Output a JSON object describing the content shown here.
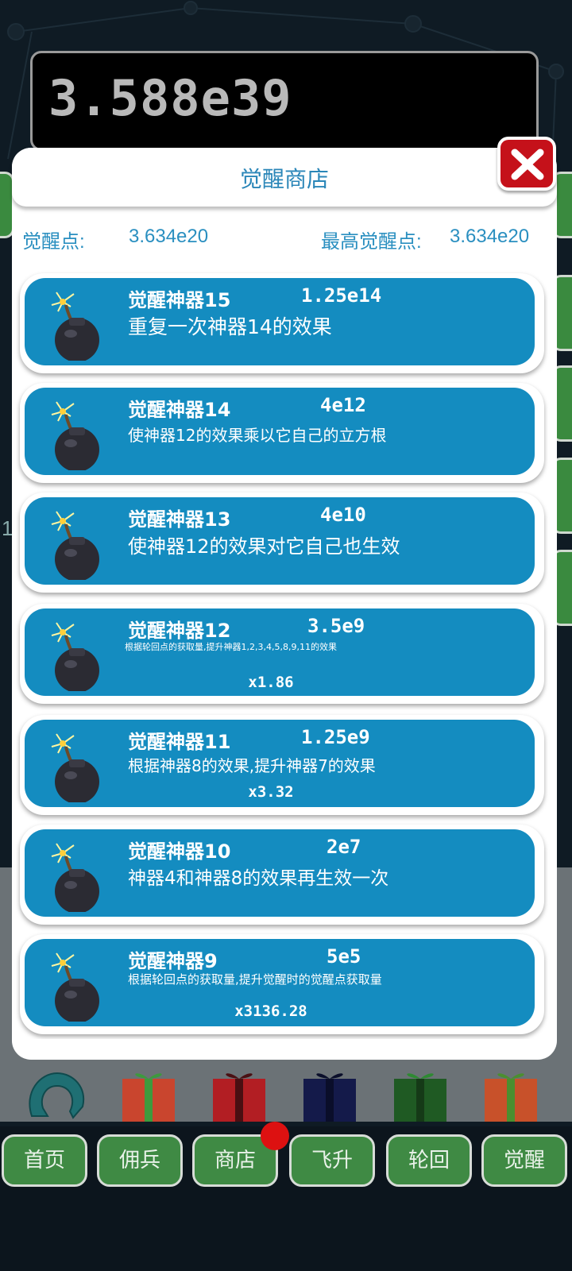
{
  "score": "3.588e39",
  "side_left_number": "1",
  "modal": {
    "title": "觉醒商店",
    "awaken_points_label": "觉醒点:",
    "awaken_points_value": "3.634e20",
    "max_awaken_points_label": "最高觉醒点:",
    "max_awaken_points_value": "3.634e20"
  },
  "items": [
    {
      "name": "觉醒神器15",
      "cost": "1.25e14",
      "desc": "重复一次神器14的效果",
      "mult": ""
    },
    {
      "name": "觉醒神器14",
      "cost": "4e12",
      "desc": "使神器12的效果乘以它自己的立方根",
      "mult": ""
    },
    {
      "name": "觉醒神器13",
      "cost": "4e10",
      "desc": "使神器12的效果对它自己也生效",
      "mult": ""
    },
    {
      "name": "觉醒神器12",
      "cost": "3.5e9",
      "desc": "根据轮回点的获取量,提升神器1,2,3,4,5,8,9,11的效果",
      "mult": "x1.86"
    },
    {
      "name": "觉醒神器11",
      "cost": "1.25e9",
      "desc": "根据神器8的效果,提升神器7的效果",
      "mult": "x3.32"
    },
    {
      "name": "觉醒神器10",
      "cost": "2e7",
      "desc": "神器4和神器8的效果再生效一次",
      "mult": ""
    },
    {
      "name": "觉醒神器9",
      "cost": "5e5",
      "desc": "根据轮回点的获取量,提升觉醒时的觉醒点获取量",
      "mult": "x3136.28"
    }
  ],
  "nav": [
    "首页",
    "佣兵",
    "商店",
    "飞升",
    "轮回",
    "觉醒"
  ],
  "colors": {
    "item_bg": "#148cc0",
    "accent_text": "#2a8fc0",
    "nav_green": "#3f8a44",
    "close_red": "#c5111a"
  },
  "icons": {
    "item_icon": "bomb-icon",
    "close_icon": "close-icon",
    "gift_icon": "gift-icon",
    "horseshoe_icon": "horseshoe-icon"
  }
}
